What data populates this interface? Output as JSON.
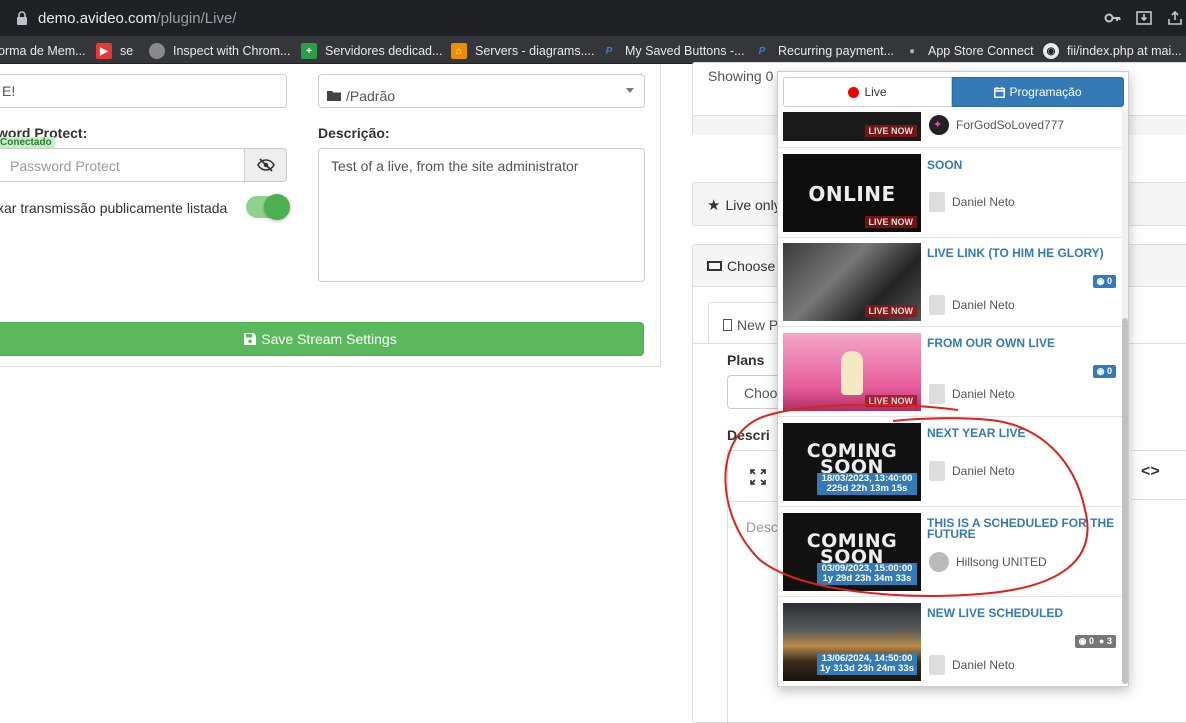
{
  "browser": {
    "url_host": "demo.avideo.com",
    "url_path": "/plugin/Live/",
    "bookmarks": [
      {
        "label": "orma de Mem...",
        "color": "#555"
      },
      {
        "label": "se",
        "color": "#e53935"
      },
      {
        "label": "Inspect with Chrom...",
        "color": "#8a8a8a"
      },
      {
        "label": "Servidores dedicad...",
        "color": "#2e9d4a"
      },
      {
        "label": "Servers - diagrams....",
        "color": "#f08c00"
      },
      {
        "label": "My Saved Buttons -...",
        "color": "#1e4fa3"
      },
      {
        "label": "Recurring payment...",
        "color": "#1e4fa3"
      },
      {
        "label": "App Store Connect",
        "color": "#666"
      },
      {
        "label": "fii/index.php at mai...",
        "color": "#ddd"
      }
    ]
  },
  "form": {
    "title_value": "E!",
    "category_value": "/Padrão",
    "password_label": "word Protect:",
    "connected_badge": "Conectado",
    "password_placeholder": "Password Protect",
    "description_label": "Descrição:",
    "description_value": "Test of a live, from the site administrator",
    "listed_label": "xar transmissão publicamente listada",
    "save_label": "Save Stream Settings"
  },
  "right": {
    "showing_text": "Showing 0 f",
    "live_only_label": "Live only",
    "choose_label": "Choose",
    "new_tab_label": "New P",
    "plans_label": "Plans",
    "plans_select": "Choo",
    "descr_label": "Descri",
    "desc_placeholder": "Desc"
  },
  "dropdown": {
    "tab_live": "Live",
    "tab_programacao": "Programação",
    "items": [
      {
        "title": "",
        "user": "ForGodSoLoved777",
        "thumb_text": "",
        "badge": "LIVE NOW",
        "views": ""
      },
      {
        "title": "SOON",
        "user": "Daniel Neto",
        "thumb_text": "ONLINE",
        "badge": "LIVE NOW",
        "views": ""
      },
      {
        "title": "LIVE LINK (TO HIM HE GLORY)",
        "user": "Daniel Neto",
        "thumb_text": "",
        "badge": "LIVE NOW",
        "views": "0"
      },
      {
        "title": "FROM OUR OWN LIVE",
        "user": "Daniel Neto",
        "thumb_text": "",
        "badge": "LIVE NOW",
        "views": "0"
      },
      {
        "title": "NEXT YEAR LIVE",
        "user": "Daniel Neto",
        "thumb_text": "COMING SOON",
        "date": "18/03/2023, 13:40:00",
        "countdown": "225d 22h 13m 15s"
      },
      {
        "title": "THIS IS A SCHEDULED FOR THE FUTURE",
        "user": "Hillsong UNITED",
        "thumb_text": "COMING SOON",
        "date": "03/09/2023, 15:00:00",
        "countdown": "1y 29d 23h 34m 33s"
      },
      {
        "title": "NEW LIVE SCHEDULED",
        "user": "Daniel Neto",
        "thumb_text": "",
        "date": "13/06/2024, 14:50:00",
        "countdown": "1y 313d 23h 24m 33s",
        "views": "0",
        "viewers": "3"
      }
    ]
  },
  "colors": {
    "annotation": "#e0201a",
    "primary": "#337ab7",
    "success": "#5cb85c"
  }
}
